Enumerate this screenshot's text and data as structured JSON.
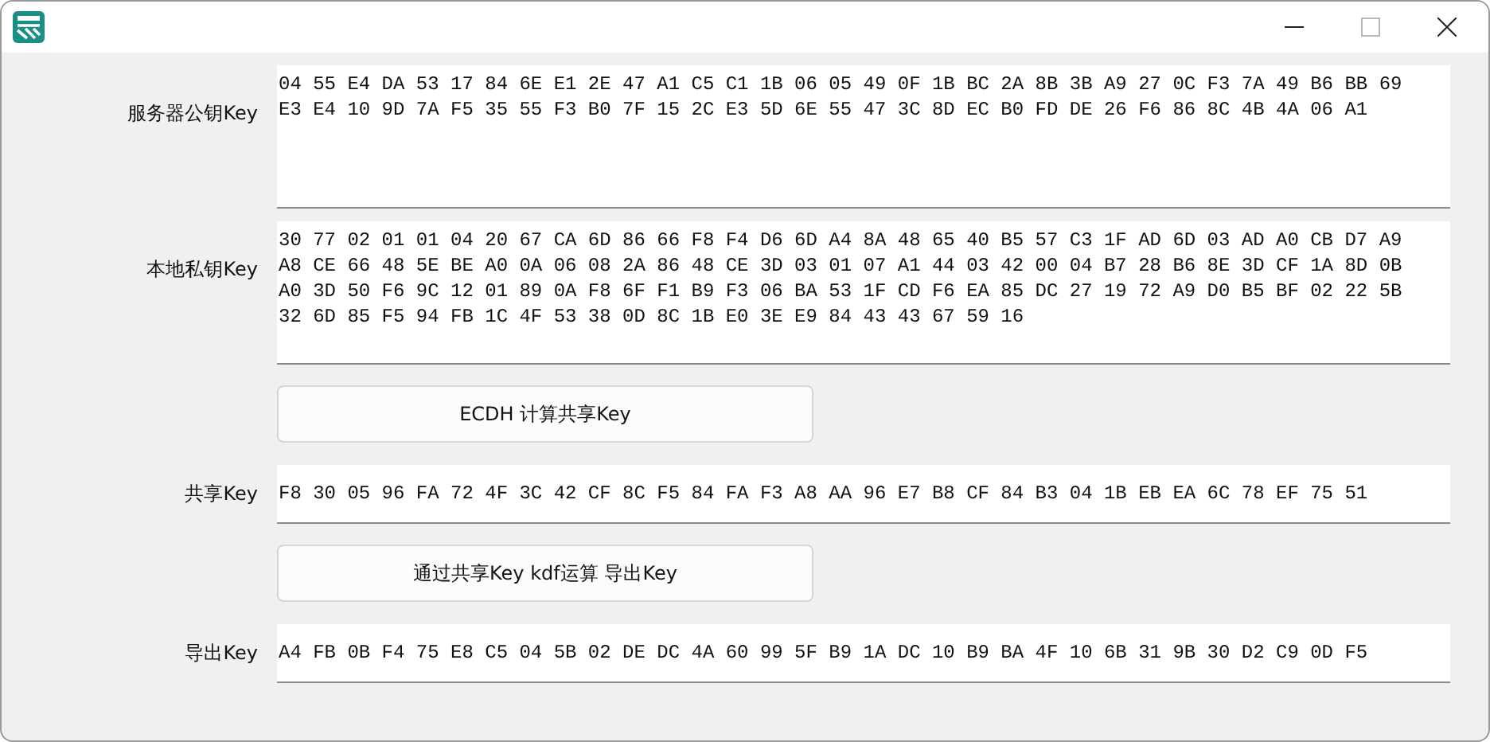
{
  "fields": [
    {
      "kind": "multiline",
      "label": "服务器公钥Key",
      "lines": [
        "04 55 E4 DA 53 17 84 6E E1 2E 47 A1 C5 C1 1B 06 05 49 0F 1B BC 2A 8B 3B A9 27 0C F3 7A 49 B6 BB 69",
        "E3 E4 10 9D 7A F5 35 55 F3 B0 7F 15 2C E3 5D 6E 55 47 3C 8D EC B0 FD DE 26 F6 86 8C 4B 4A 06 A1"
      ]
    },
    {
      "kind": "multiline",
      "label": "本地私钥Key",
      "lines": [
        "30 77 02 01 01 04 20 67 CA 6D 86 66 F8 F4 D6 6D A4 8A 48 65 40 B5 57 C3 1F AD 6D 03 AD A0 CB D7 A9",
        "A8 CE 66 48 5E BE A0 0A 06 08 2A 86 48 CE 3D 03 01 07 A1 44 03 42 00 04 B7 28 B6 8E 3D CF 1A 8D 0B",
        "A0 3D 50 F6 9C 12 01 89 0A F8 6F F1 B9 F3 06 BA 53 1F CD F6 EA 85 DC 27 19 72 A9 D0 B5 BF 02 22 5B",
        "32 6D 85 F5 94 FB 1C 4F 53 38 0D 8C 1B E0 3E E9 84 43 43 67 59 16"
      ]
    },
    {
      "kind": "button",
      "text": "ECDH 计算共享Key"
    },
    {
      "kind": "single",
      "label": "共享Key",
      "lines": [
        "F8 30 05 96 FA 72 4F 3C 42 CF 8C F5 84 FA F3 A8 AA 96 E7 B8 CF 84 B3 04 1B EB EA 6C 78 EF 75 51"
      ]
    },
    {
      "kind": "button",
      "text": "通过共享Key kdf运算 导出Key"
    },
    {
      "kind": "single",
      "label": "导出Key",
      "lines": [
        "A4 FB 0B F4 75 E8 C5 04 5B 02 DE DC 4A 60 99 5F B9 1A DC 10 B9 BA 4F 10 6B 31 9B 30 D2 C9 0D F5"
      ]
    }
  ]
}
